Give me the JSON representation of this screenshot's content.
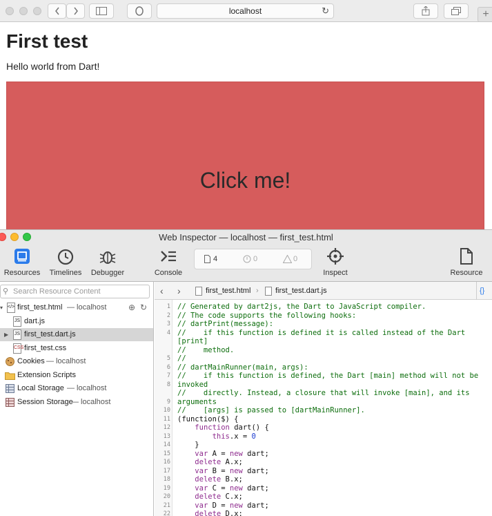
{
  "browser": {
    "url": "localhost",
    "new_tab_symbol": "+"
  },
  "page": {
    "title": "First test",
    "text": "Hello world from Dart!",
    "button_label": "Click me!",
    "button_color": "#d65c5c"
  },
  "inspector": {
    "window_title": "Web Inspector — localhost — first_test.html",
    "toolbar": {
      "resources": "Resources",
      "timelines": "Timelines",
      "debugger": "Debugger",
      "console": "Console",
      "inspect": "Inspect",
      "resource": "Resource"
    },
    "dashboard": {
      "resources_count": "4",
      "errors_count": "0",
      "warnings_count": "0"
    },
    "sidebar": {
      "search_placeholder": "Search Resource Content",
      "items": [
        {
          "label": "first_test.html",
          "suffix": " — localhost",
          "icon": "html-file-icon"
        },
        {
          "label": "dart.js",
          "suffix": "",
          "icon": "js-file-icon"
        },
        {
          "label": "first_test.dart.js",
          "suffix": "",
          "icon": "js-file-icon"
        },
        {
          "label": "first_test.css",
          "suffix": "",
          "icon": "css-file-icon"
        },
        {
          "label": "Cookies",
          "suffix": " — localhost",
          "icon": "cookie-icon"
        },
        {
          "label": "Extension Scripts",
          "suffix": "",
          "icon": "folder-icon"
        },
        {
          "label": "Local Storage",
          "suffix": " — localhost",
          "icon": "storage-icon"
        },
        {
          "label": "Session Storage",
          "suffix": " — localhost",
          "icon": "storage-icon"
        }
      ]
    },
    "editor": {
      "breadcrumb_1": "first_test.html",
      "breadcrumb_2": "first_test.dart.js",
      "format_symbol": "{}",
      "lines": [
        {
          "n": "1",
          "parts": [
            {
              "t": "// Generated by dart2js, the Dart to JavaScript compiler.",
              "c": "cmt"
            }
          ]
        },
        {
          "n": "2",
          "parts": [
            {
              "t": "// The code supports the following hooks:",
              "c": "cmt"
            }
          ]
        },
        {
          "n": "3",
          "parts": [
            {
              "t": "// dartPrint(message):",
              "c": "cmt"
            }
          ]
        },
        {
          "n": "4",
          "parts": [
            {
              "t": "//    if this function is defined it is called instead of the Dart",
              "c": "cmt"
            }
          ]
        },
        {
          "n": "",
          "parts": [
            {
              "t": "[print]",
              "c": "cmt"
            }
          ]
        },
        {
          "n": "",
          "parts": [
            {
              "t": "//    method.",
              "c": "cmt"
            }
          ]
        },
        {
          "n": "5",
          "parts": [
            {
              "t": "//",
              "c": "cmt"
            }
          ]
        },
        {
          "n": "6",
          "parts": [
            {
              "t": "// dartMainRunner(main, args):",
              "c": "cmt"
            }
          ]
        },
        {
          "n": "7",
          "parts": [
            {
              "t": "//    if this function is defined, the Dart [main] method will not be",
              "c": "cmt"
            }
          ]
        },
        {
          "n": "8",
          "parts": [
            {
              "t": "invoked",
              "c": "cmt"
            }
          ]
        },
        {
          "n": "",
          "parts": [
            {
              "t": "//    directly. Instead, a closure that will invoke [main], and its",
              "c": "cmt"
            }
          ]
        },
        {
          "n": "9",
          "parts": [
            {
              "t": "arguments",
              "c": "cmt"
            }
          ]
        },
        {
          "n": "10",
          "parts": [
            {
              "t": "//    [args] is passed to [dartMainRunner].",
              "c": "cmt"
            }
          ]
        },
        {
          "n": "11",
          "parts": [
            {
              "t": "(function($) {",
              "c": "plain"
            }
          ]
        },
        {
          "n": "12",
          "parts": [
            {
              "t": "    ",
              "c": "plain"
            },
            {
              "t": "function",
              "c": "kw"
            },
            {
              "t": " dart() {",
              "c": "plain"
            }
          ]
        },
        {
          "n": "13",
          "parts": [
            {
              "t": "        ",
              "c": "plain"
            },
            {
              "t": "this",
              "c": "kw"
            },
            {
              "t": ".x = ",
              "c": "plain"
            },
            {
              "t": "0",
              "c": "num"
            }
          ]
        },
        {
          "n": "14",
          "parts": [
            {
              "t": "    }",
              "c": "plain"
            }
          ]
        },
        {
          "n": "15",
          "parts": [
            {
              "t": "    ",
              "c": "plain"
            },
            {
              "t": "var",
              "c": "kw"
            },
            {
              "t": " A = ",
              "c": "plain"
            },
            {
              "t": "new",
              "c": "kw"
            },
            {
              "t": " dart;",
              "c": "plain"
            }
          ]
        },
        {
          "n": "16",
          "parts": [
            {
              "t": "    ",
              "c": "plain"
            },
            {
              "t": "delete",
              "c": "kw"
            },
            {
              "t": " A.x;",
              "c": "plain"
            }
          ]
        },
        {
          "n": "17",
          "parts": [
            {
              "t": "    ",
              "c": "plain"
            },
            {
              "t": "var",
              "c": "kw"
            },
            {
              "t": " B = ",
              "c": "plain"
            },
            {
              "t": "new",
              "c": "kw"
            },
            {
              "t": " dart;",
              "c": "plain"
            }
          ]
        },
        {
          "n": "18",
          "parts": [
            {
              "t": "    ",
              "c": "plain"
            },
            {
              "t": "delete",
              "c": "kw"
            },
            {
              "t": " B.x;",
              "c": "plain"
            }
          ]
        },
        {
          "n": "19",
          "parts": [
            {
              "t": "    ",
              "c": "plain"
            },
            {
              "t": "var",
              "c": "kw"
            },
            {
              "t": " C = ",
              "c": "plain"
            },
            {
              "t": "new",
              "c": "kw"
            },
            {
              "t": " dart;",
              "c": "plain"
            }
          ]
        },
        {
          "n": "20",
          "parts": [
            {
              "t": "    ",
              "c": "plain"
            },
            {
              "t": "delete",
              "c": "kw"
            },
            {
              "t": " C.x;",
              "c": "plain"
            }
          ]
        },
        {
          "n": "21",
          "parts": [
            {
              "t": "    ",
              "c": "plain"
            },
            {
              "t": "var",
              "c": "kw"
            },
            {
              "t": " D = ",
              "c": "plain"
            },
            {
              "t": "new",
              "c": "kw"
            },
            {
              "t": " dart;",
              "c": "plain"
            }
          ]
        },
        {
          "n": "22",
          "parts": [
            {
              "t": "    ",
              "c": "plain"
            },
            {
              "t": "delete",
              "c": "kw"
            },
            {
              "t": " D.x;",
              "c": "plain"
            }
          ]
        }
      ]
    }
  }
}
